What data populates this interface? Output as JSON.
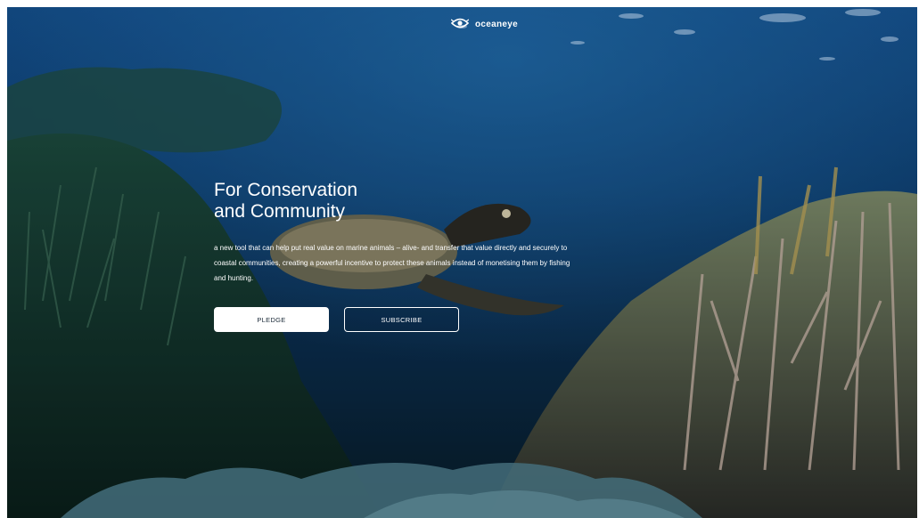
{
  "brand": {
    "name": "oceaneye",
    "logo_icon": "eye-icon",
    "text_color": "#ffffff"
  },
  "hero": {
    "title_line1": "For Conservation",
    "title_line2": "and Community",
    "description": "a new tool that can help put real value on marine animals – alive- and transfer that value directly and securely to coastal communities, creating a powerful incentive to protect these animals instead of monetising them by fishing and hunting.",
    "background_image": "underwater-coral-reef-turtle"
  },
  "actions": {
    "pledge_label": "PLEDGE",
    "subscribe_label": "SUBSCRIBE"
  },
  "colors": {
    "ocean_top": "#114a87",
    "ocean_mid": "#0b3a66",
    "reef_dark": "#0a2222",
    "button_primary_bg": "#ffffff",
    "button_secondary_border": "#ffffff"
  }
}
